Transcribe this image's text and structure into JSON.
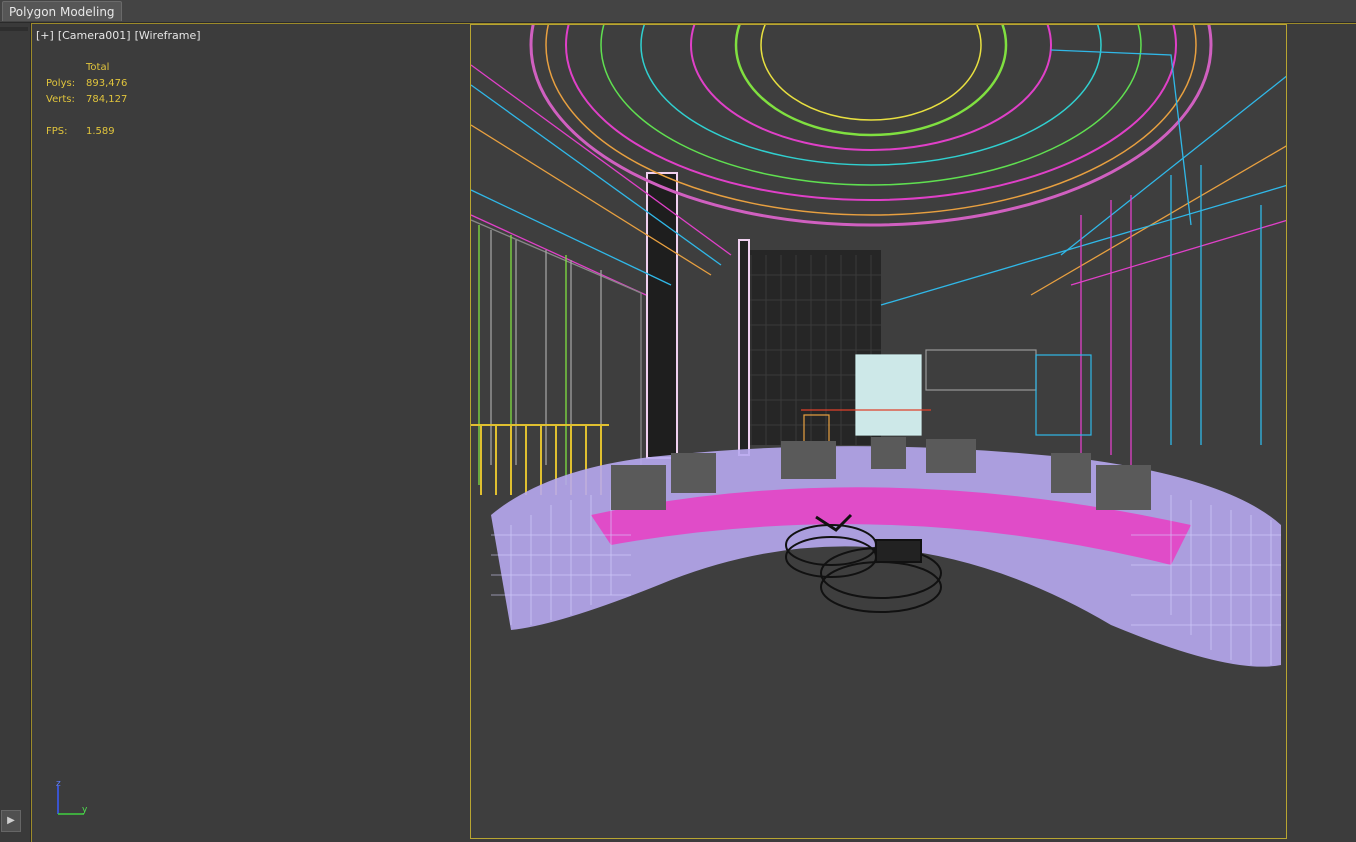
{
  "ribbon": {
    "tab_label": "Polygon Modeling"
  },
  "viewport": {
    "label_parts": [
      "[+]",
      "[Camera001]",
      "[Wireframe]"
    ],
    "stats": {
      "header": "Total",
      "polys_label": "Polys:",
      "polys_value": "893,476",
      "verts_label": "Verts:",
      "verts_value": "784,127",
      "fps_label": "FPS:",
      "fps_value": "1.589"
    },
    "axis": {
      "z": "z",
      "y": "y"
    }
  },
  "colors": {
    "safe_frame": "#b8a531",
    "stats_text": "#e0c43c",
    "wire_magenta": "#e040c8",
    "wire_cyan": "#30b8e8",
    "wire_green": "#60e050",
    "wire_lavender": "#a8a8f0",
    "wire_yellow": "#e0c030"
  },
  "icons": {
    "play": "play-triangle-icon",
    "axis": "axis-tripod-icon"
  }
}
